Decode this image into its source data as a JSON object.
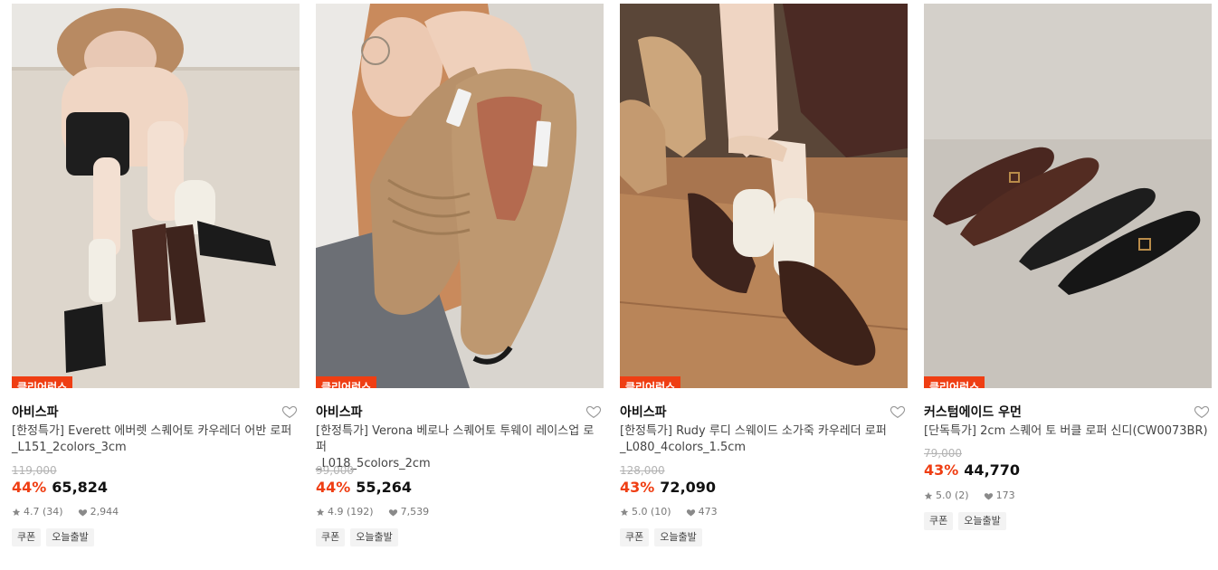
{
  "products": [
    {
      "badge": "클리어런스",
      "brand": "아비스파",
      "name_line1": "[한정특가] Everett 에버렛 스퀘어토 카우레더 어반 로퍼",
      "name_line2": "_L151_2colors_3cm",
      "original_price": "119,000",
      "discount": "44%",
      "price": "65,824",
      "rating": "4.7 (34)",
      "likes": "2,944",
      "tags": [
        "쿠폰",
        "오늘출발"
      ],
      "image_icon": "model-sitting-with-square-toe-loafers"
    },
    {
      "badge": "클리어런스",
      "brand": "아비스파",
      "name_line1": "[한정특가] Verona 베로나 스퀘어토 투웨이 레이스업 로퍼",
      "name_line2": "_L018_5colors_2cm",
      "original_price": "99,000",
      "discount": "44%",
      "price": "55,264",
      "rating": "4.9 (192)",
      "likes": "7,539",
      "tags": [
        "쿠폰",
        "오늘출발"
      ],
      "image_icon": "model-holding-beige-suede-laceup-shoes"
    },
    {
      "badge": "클리어런스",
      "brand": "아비스파",
      "name_line1": "[한정특가] Rudy 루디 스웨이드 소가죽 카우레더 로퍼",
      "name_line2": "_L080_4colors_1.5cm",
      "original_price": "128,000",
      "discount": "43%",
      "price": "72,090",
      "rating": "5.0 (10)",
      "likes": "473",
      "tags": [
        "쿠폰",
        "오늘출발"
      ],
      "image_icon": "model-wearing-brown-suede-moccasins"
    },
    {
      "badge": "클리어런스",
      "brand": "커스텀에이드 우먼",
      "name_line1": "[단독특가] 2cm 스퀘어 토 버클 로퍼 신디(CW0073BR)",
      "name_line2": "",
      "original_price": "79,000",
      "discount": "43%",
      "price": "44,770",
      "rating": "5.0 (2)",
      "likes": "173",
      "tags": [
        "쿠폰",
        "오늘출발"
      ],
      "image_icon": "brown-and-black-buckle-loafers"
    }
  ],
  "colors": {
    "accent": "#ef3e13",
    "tag_bg": "#f3f3f3",
    "muted": "#b3b3b3"
  },
  "icons": {
    "wishlist": "heart-outline-icon",
    "rating": "star-icon",
    "likes": "heart-filled-icon"
  }
}
